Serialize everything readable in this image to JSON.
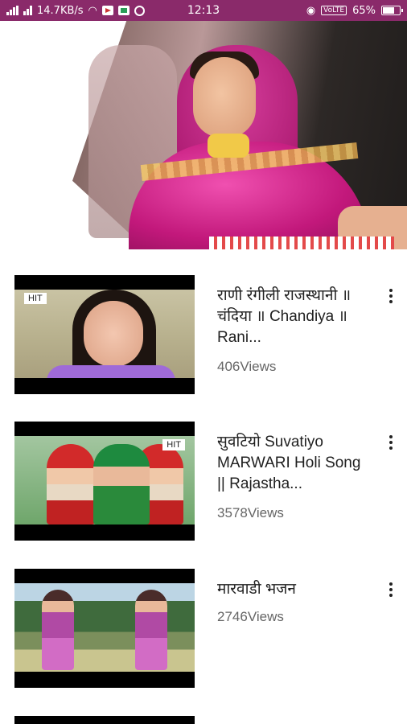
{
  "status_bar": {
    "speed": "14.7KB/s",
    "time": "12:13",
    "volte": "VoLTE",
    "battery": "65%"
  },
  "videos": [
    {
      "badge": "HIT",
      "title": "राणी रंगीली राजस्थानी ॥ चंदिया ॥ Chandiya ॥  Rani...",
      "views": "406Views"
    },
    {
      "badge": "HIT",
      "title": "सुवटियो Suvatiyo MARWARI Holi Song || Rajastha...",
      "views": "3578Views"
    },
    {
      "title": "मारवाडी भजन",
      "views": "2746Views"
    }
  ],
  "colors": {
    "status_bar": "#8a2a6a",
    "title_text": "#212121",
    "views_text": "#666666"
  }
}
